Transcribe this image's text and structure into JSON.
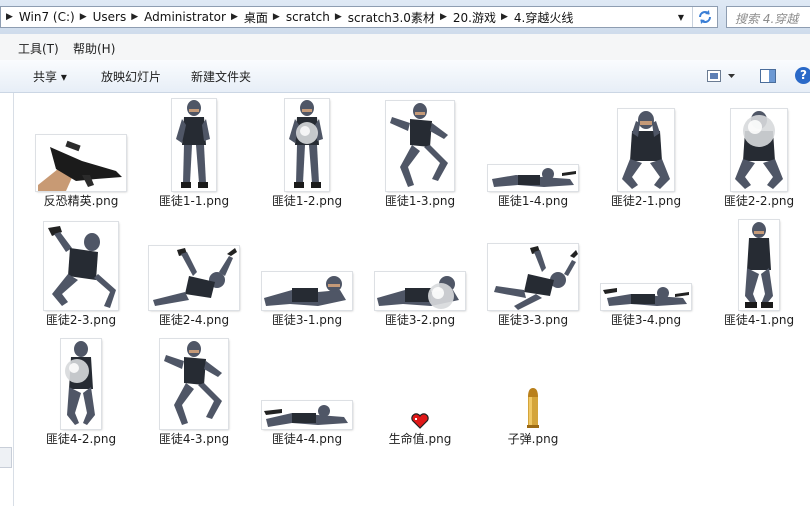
{
  "address_bar": {
    "crumbs": [
      "Win7 (C:)",
      "Users",
      "Administrator",
      "桌面",
      "scratch",
      "scratch3.0素材",
      "20.游戏",
      "4.穿越火线"
    ],
    "search_placeholder": "搜索 4.穿越"
  },
  "menu": {
    "items": [
      "工具(T)",
      "帮助(H)"
    ]
  },
  "toolbar": {
    "share": "共享 ▾",
    "slideshow": "放映幻灯片",
    "new_folder": "新建文件夹",
    "help": "?"
  },
  "files": [
    {
      "name": "反恐精英.png",
      "type": "gun"
    },
    {
      "name": "匪徒1-1.png",
      "type": "stand"
    },
    {
      "name": "匪徒1-2.png",
      "type": "stand-shield"
    },
    {
      "name": "匪徒1-3.png",
      "type": "leap"
    },
    {
      "name": "匪徒1-4.png",
      "type": "lying"
    },
    {
      "name": "匪徒2-1.png",
      "type": "crouch"
    },
    {
      "name": "匪徒2-2.png",
      "type": "crouch-shield"
    },
    {
      "name": "匪徒2-3.png",
      "type": "fall"
    },
    {
      "name": "匪徒2-4.png",
      "type": "sprawl"
    },
    {
      "name": "匪徒3-1.png",
      "type": "prone"
    },
    {
      "name": "匪徒3-2.png",
      "type": "prone-shield"
    },
    {
      "name": "匪徒3-3.png",
      "type": "sprawl"
    },
    {
      "name": "匪徒3-4.png",
      "type": "lying"
    },
    {
      "name": "匪徒4-1.png",
      "type": "kneel"
    },
    {
      "name": "匪徒4-2.png",
      "type": "kneel-shield"
    },
    {
      "name": "匪徒4-3.png",
      "type": "leap"
    },
    {
      "name": "匪徒4-4.png",
      "type": "lying"
    },
    {
      "name": "生命值.png",
      "type": "heart"
    },
    {
      "name": "子弹.png",
      "type": "bullet"
    }
  ],
  "colors": {
    "accent": "#2a69c8",
    "suit": "#4f5666",
    "vest": "#262b33",
    "skin": "#c59a78"
  }
}
